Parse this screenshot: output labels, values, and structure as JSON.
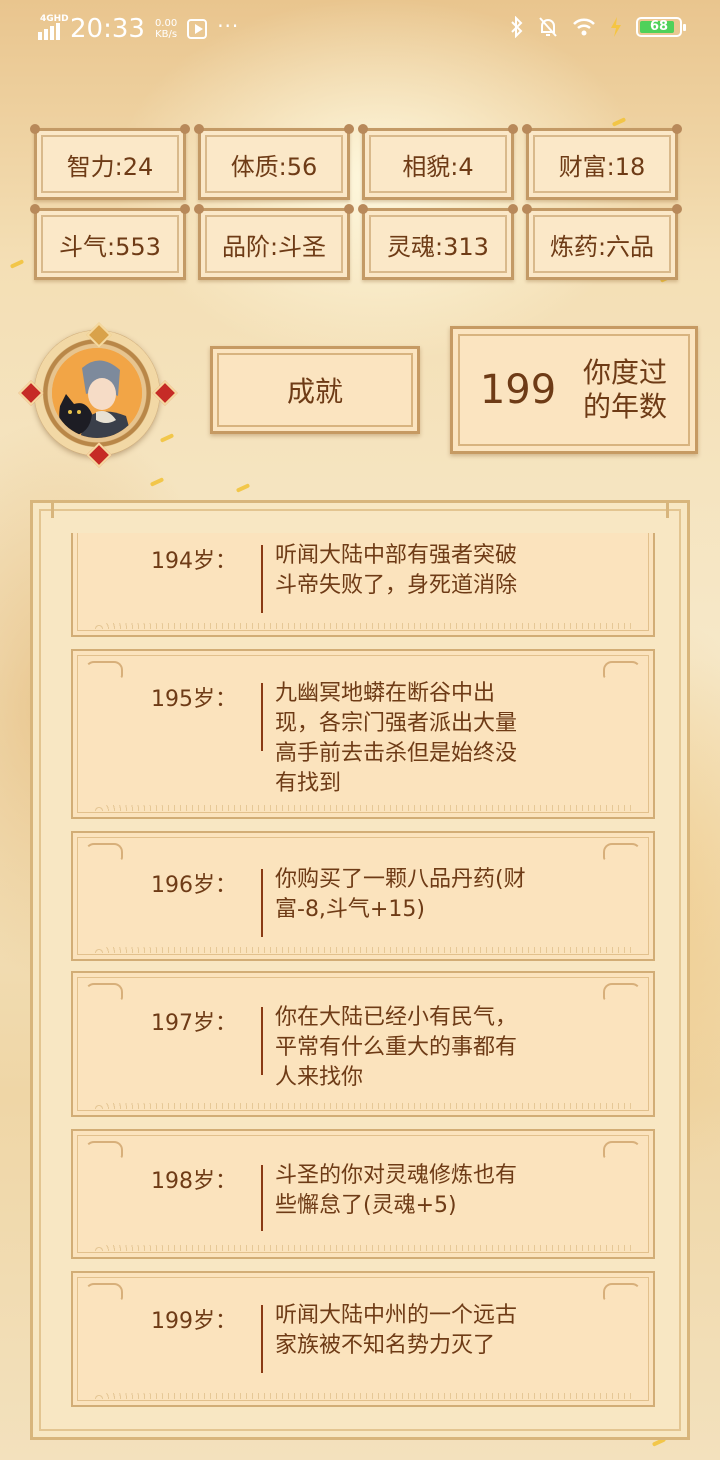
{
  "status_bar": {
    "network": "4GHD",
    "time": "20:33",
    "speed_value": "0.00",
    "speed_unit": "KB/s",
    "battery": "68"
  },
  "stats": [
    "智力:24",
    "体质:56",
    "相貌:4",
    "财富:18",
    "斗气:553",
    "品阶:斗圣",
    "灵魂:313",
    "炼药:六品"
  ],
  "achievement_button": "成就",
  "years": {
    "value": "199",
    "label_line1": "你度过",
    "label_line2": "的年数"
  },
  "log": [
    {
      "age": "194岁：",
      "lines": [
        "听闻大陆中部有强者突破",
        "斗帝失败了，身死道消除"
      ]
    },
    {
      "age": "195岁：",
      "lines": [
        "九幽冥地蟒在断谷中出",
        "现，各宗门强者派出大量",
        "高手前去击杀但是始终没",
        "有找到"
      ]
    },
    {
      "age": "196岁：",
      "lines": [
        "你购买了一颗八品丹药(财",
        "富-8,斗气+15)"
      ]
    },
    {
      "age": "197岁：",
      "lines": [
        "你在大陆已经小有民气，",
        "平常有什么重大的事都有",
        "人来找你"
      ]
    },
    {
      "age": "198岁：",
      "lines": [
        "斗圣的你对灵魂修炼也有",
        "些懈怠了(灵魂+5)"
      ]
    },
    {
      "age": "199岁：",
      "lines": [
        "听闻大陆中州的一个远古",
        "家族被不知名势力灭了"
      ]
    }
  ]
}
